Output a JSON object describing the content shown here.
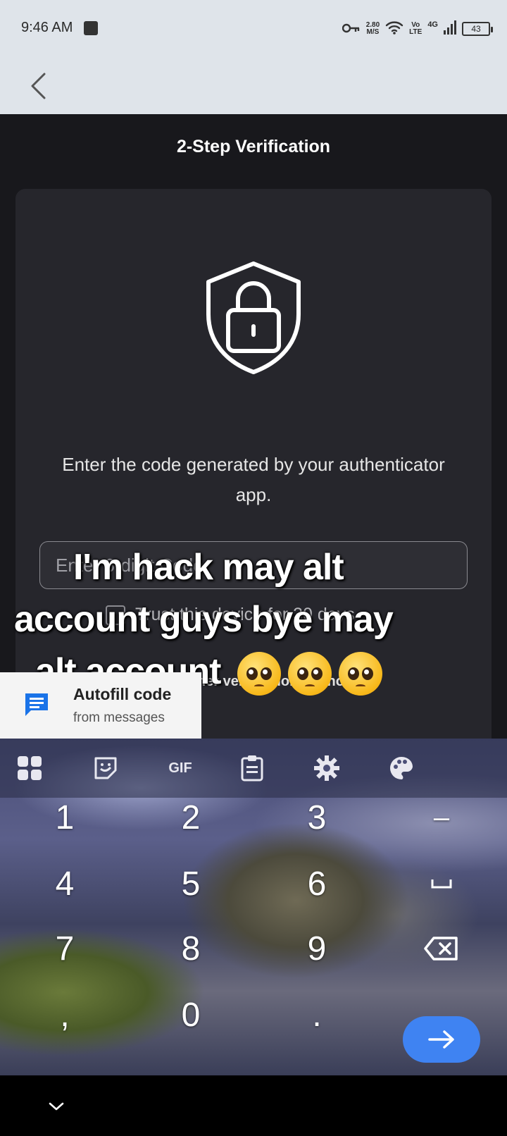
{
  "status_bar": {
    "time": "9:46 AM",
    "speed_value": "2.80",
    "speed_unit": "M/S",
    "volte_top": "Vo",
    "volte_bottom": "LTE",
    "network": "4G",
    "battery": "43",
    "icons": [
      "notification-icon",
      "vpn-key-icon",
      "wifi-icon",
      "signal-icon",
      "battery-icon"
    ]
  },
  "app_bar": {
    "back_icon": "chevron-left-icon"
  },
  "page": {
    "title": "2-Step Verification",
    "shield_icon": "shield-lock-icon",
    "instruction": "Enter the code generated by your authenticator app.",
    "code_placeholder": "Enter 6-digit Code",
    "code_value": "",
    "trust_label": "Trust this device for 30 days",
    "trust_checked": false,
    "other_method_label": "Use other verification method"
  },
  "overlay_caption": {
    "line1": "I'm hack may alt",
    "line2": "account guys bye may",
    "line3": "alt account",
    "emoji": [
      "🥺",
      "🥺",
      "🥺"
    ]
  },
  "autofill": {
    "icon": "message-icon",
    "title": "Autofill code",
    "subtitle": "from messages"
  },
  "keyboard": {
    "toolbar_icons": [
      "apps-grid-icon",
      "sticker-icon",
      "gif-icon",
      "clipboard-icon",
      "settings-gear-icon",
      "palette-icon"
    ],
    "gif_label": "GIF",
    "rows": [
      [
        "1",
        "2",
        "3",
        "–"
      ],
      [
        "4",
        "5",
        "6",
        "␣"
      ],
      [
        "7",
        "8",
        "9",
        "⌫"
      ],
      [
        ",",
        "0",
        ".",
        "→"
      ]
    ]
  },
  "nav_bar": {
    "hide_keyboard_icon": "chevron-down-icon"
  },
  "colors": {
    "status_bar_bg": "#dfe4ea",
    "page_bg": "#18181c",
    "card_bg": "#26262c",
    "enter_key": "#3f83f2",
    "autofill_icon": "#1a73e8"
  }
}
